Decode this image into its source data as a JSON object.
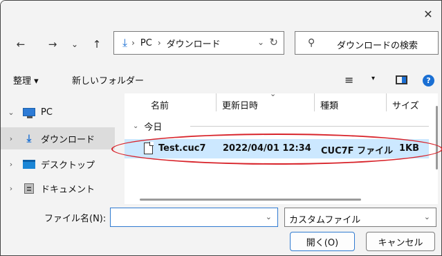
{
  "window": {
    "close_glyph": "✕"
  },
  "nav": {
    "back_glyph": "←",
    "forward_glyph": "→",
    "recent_glyph": "⌄",
    "up_glyph": "↑",
    "address": {
      "download_icon": "download-arrow-icon",
      "segments": [
        "PC",
        "ダウンロード"
      ],
      "separator": "›",
      "refresh_glyph": "↻",
      "dropdown_glyph": "⌄"
    },
    "search_placeholder": "ダウンロードの検索",
    "search_icon": "search-icon"
  },
  "toolbar": {
    "organize_label": "整理 ▾",
    "new_folder_label": "新しいフォルダー",
    "view_menu_glyph": "≡",
    "view_caret_glyph": "▾",
    "help_glyph": "?"
  },
  "sidebar": {
    "items": [
      {
        "expander": "⌄",
        "icon": "pc-icon",
        "label": "PC"
      },
      {
        "expander": "›",
        "icon": "download-icon",
        "label": "ダウンロード",
        "selected": true
      },
      {
        "expander": "›",
        "icon": "desktop-icon",
        "label": "デスクトップ"
      },
      {
        "expander": "›",
        "icon": "documents-icon",
        "label": "ドキュメント"
      }
    ]
  },
  "file_list": {
    "columns": [
      "名前",
      "更新日時",
      "種類",
      "サイズ"
    ],
    "sort_glyph": "⌄",
    "group": {
      "chev": "⌄",
      "label": "今日"
    },
    "rows": [
      {
        "name": "Test.cuc7",
        "modified": "2022/04/01 12:34",
        "type": "CUC7F ファイル",
        "size": "1KB"
      }
    ]
  },
  "bottom": {
    "filename_label": "ファイル名(N):",
    "filename_value": "",
    "filename_dropdown_glyph": "⌄",
    "filetype_value": "カスタムファイル",
    "filetype_dropdown_glyph": "⌄",
    "open_label": "開く(O)",
    "cancel_label": "キャンセル"
  },
  "colors": {
    "accent": "#1a6fd3",
    "selection": "#cce8ff",
    "annotation": "#d8232a"
  }
}
